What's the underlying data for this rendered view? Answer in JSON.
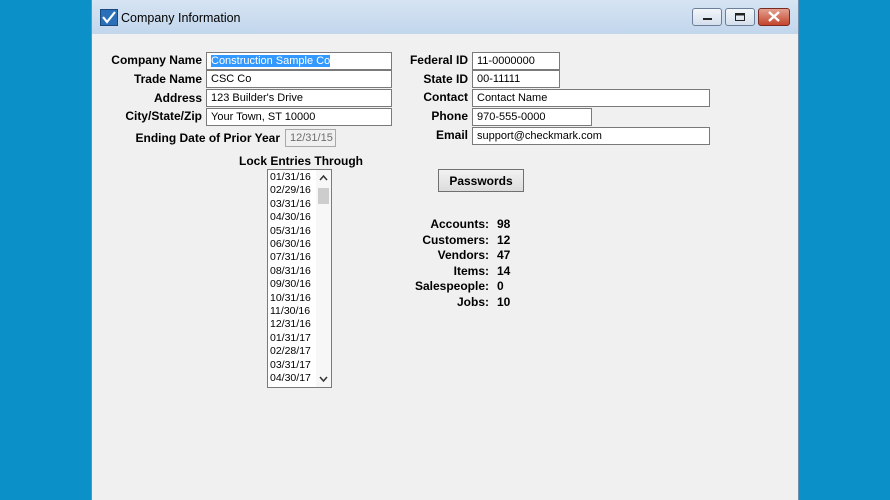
{
  "window": {
    "title": "Company Information"
  },
  "labels": {
    "company_name": "Company Name",
    "trade_name": "Trade Name",
    "address": "Address",
    "city_state_zip": "City/State/Zip",
    "ending_date_prior_year": "Ending Date of Prior Year",
    "lock_entries_through": "Lock Entries Through",
    "federal_id": "Federal ID",
    "state_id": "State ID",
    "contact": "Contact",
    "phone": "Phone",
    "email": "Email"
  },
  "values": {
    "company_name": "Construction Sample Co",
    "trade_name": "CSC Co",
    "address": "123 Builder's Drive",
    "city_state_zip": "Your Town, ST  10000",
    "ending_date_prior_year": "12/31/15",
    "federal_id": "11-0000000",
    "state_id": "00-11111",
    "contact": "Contact Name",
    "phone": "970-555-0000",
    "email": "support@checkmark.com"
  },
  "passwords_button": "Passwords",
  "lock_dates": [
    "01/31/16",
    "02/29/16",
    "03/31/16",
    "04/30/16",
    "05/31/16",
    "06/30/16",
    "07/31/16",
    "08/31/16",
    "09/30/16",
    "10/31/16",
    "11/30/16",
    "12/31/16",
    "01/31/17",
    "02/28/17",
    "03/31/17",
    "04/30/17"
  ],
  "stats": [
    {
      "label": "Accounts:",
      "value": "98"
    },
    {
      "label": "Customers:",
      "value": "12"
    },
    {
      "label": "Vendors:",
      "value": "47"
    },
    {
      "label": "Items:",
      "value": "14"
    },
    {
      "label": "Salespeople:",
      "value": "0"
    },
    {
      "label": "Jobs:",
      "value": "10"
    }
  ],
  "icons": {
    "app": "checkmark-app-icon",
    "minimize": "minimize-icon",
    "maximize": "maximize-icon",
    "close": "close-icon",
    "scroll_up": "chevron-up-icon",
    "scroll_down": "chevron-down-icon"
  },
  "colors": {
    "desktop": "#0b90c8",
    "selection": "#3399ff",
    "close_button": "#c4452c"
  }
}
